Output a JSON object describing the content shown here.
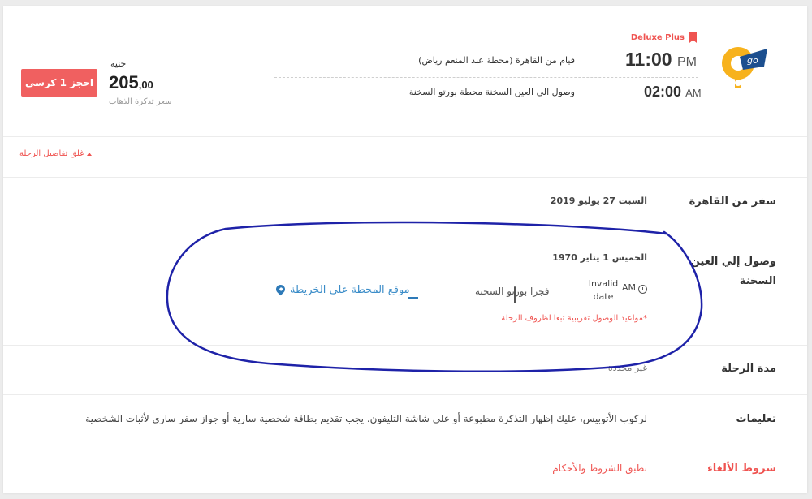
{
  "trip": {
    "class_label": "Deluxe Plus",
    "departure_time": "11:00",
    "departure_ampm": "PM",
    "departure_route": "قيام من القاهرة (محطة عبد المنعم رياض)",
    "arrival_time": "02:00",
    "arrival_ampm": "AM",
    "arrival_route": "وصول الي العين السخنة محطة بورتو السخنة"
  },
  "price": {
    "currency": "جنيه",
    "whole": "205",
    "decimal": ",00",
    "note": "سعر تذكرة الذهاب",
    "book_label": "احجز 1 كرسي"
  },
  "details": {
    "close_label": "غلق تفاصيل الرحلة",
    "departure_label": "سفر من القاهرة",
    "departure_date": "السبت 27 يوليو 2019",
    "arrival_label": "وصول إلي العين السخنة",
    "arrival_date": "الخميس 1 يناير 1970",
    "arrival_ampm": "AM",
    "arrival_invalid": "Invalid date",
    "station": "فجرا  بورتو السخنة",
    "map_link": "موقع المحطة على الخريطة",
    "arrival_note": "*مواعيد الوصول تقريبية تبعا لظروف الرحلة",
    "duration_label": "مدة الرحلة",
    "duration_value": "غير محددة",
    "instructions_label": "تعليمات",
    "instructions_text": "لركوب الأتوبيس، عليك إظهار التذكرة مطبوعة أو على شاشة التليفون. يجب تقديم بطاقة شخصية سارية أو جواز سفر ساري لأثبات الشخصية",
    "cancel_label": "شروط الألغاء",
    "terms_link": "تطبق الشروط والأحكام"
  },
  "colors": {
    "accent": "#ef5350",
    "link": "#3a8cc8",
    "annotation": "#1e22a8",
    "logo_yellow": "#f7b21d",
    "logo_blue": "#1c4f8f"
  },
  "icons": [
    "bookmark-icon",
    "clock-icon",
    "bus-icon",
    "map-pin-icon",
    "caret-up-icon"
  ]
}
